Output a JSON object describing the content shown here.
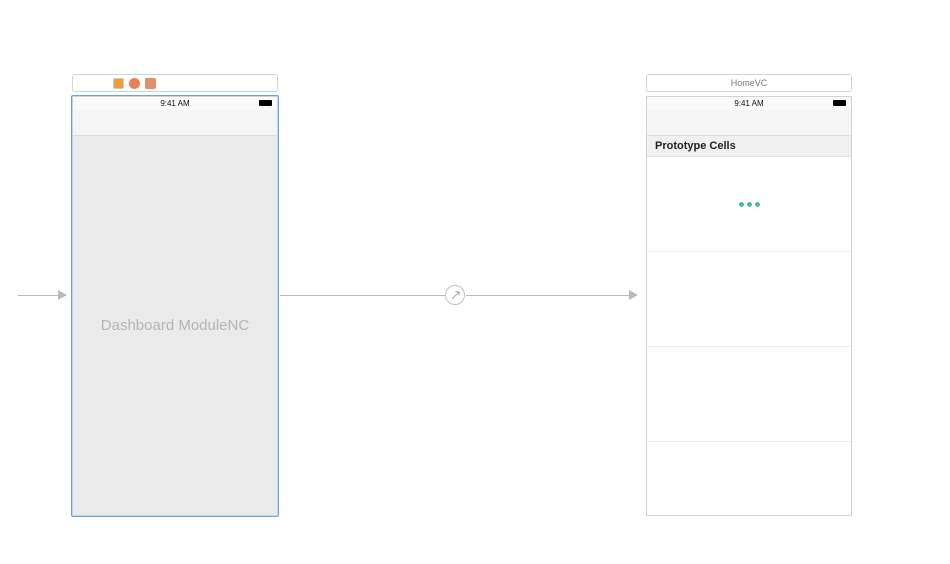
{
  "scene1": {
    "status_time": "9:41 AM",
    "placeholder": "Dashboard ModuleNC"
  },
  "scene2": {
    "title": "HomeVC",
    "status_time": "9:41 AM",
    "section_header": "Prototype Cells"
  }
}
